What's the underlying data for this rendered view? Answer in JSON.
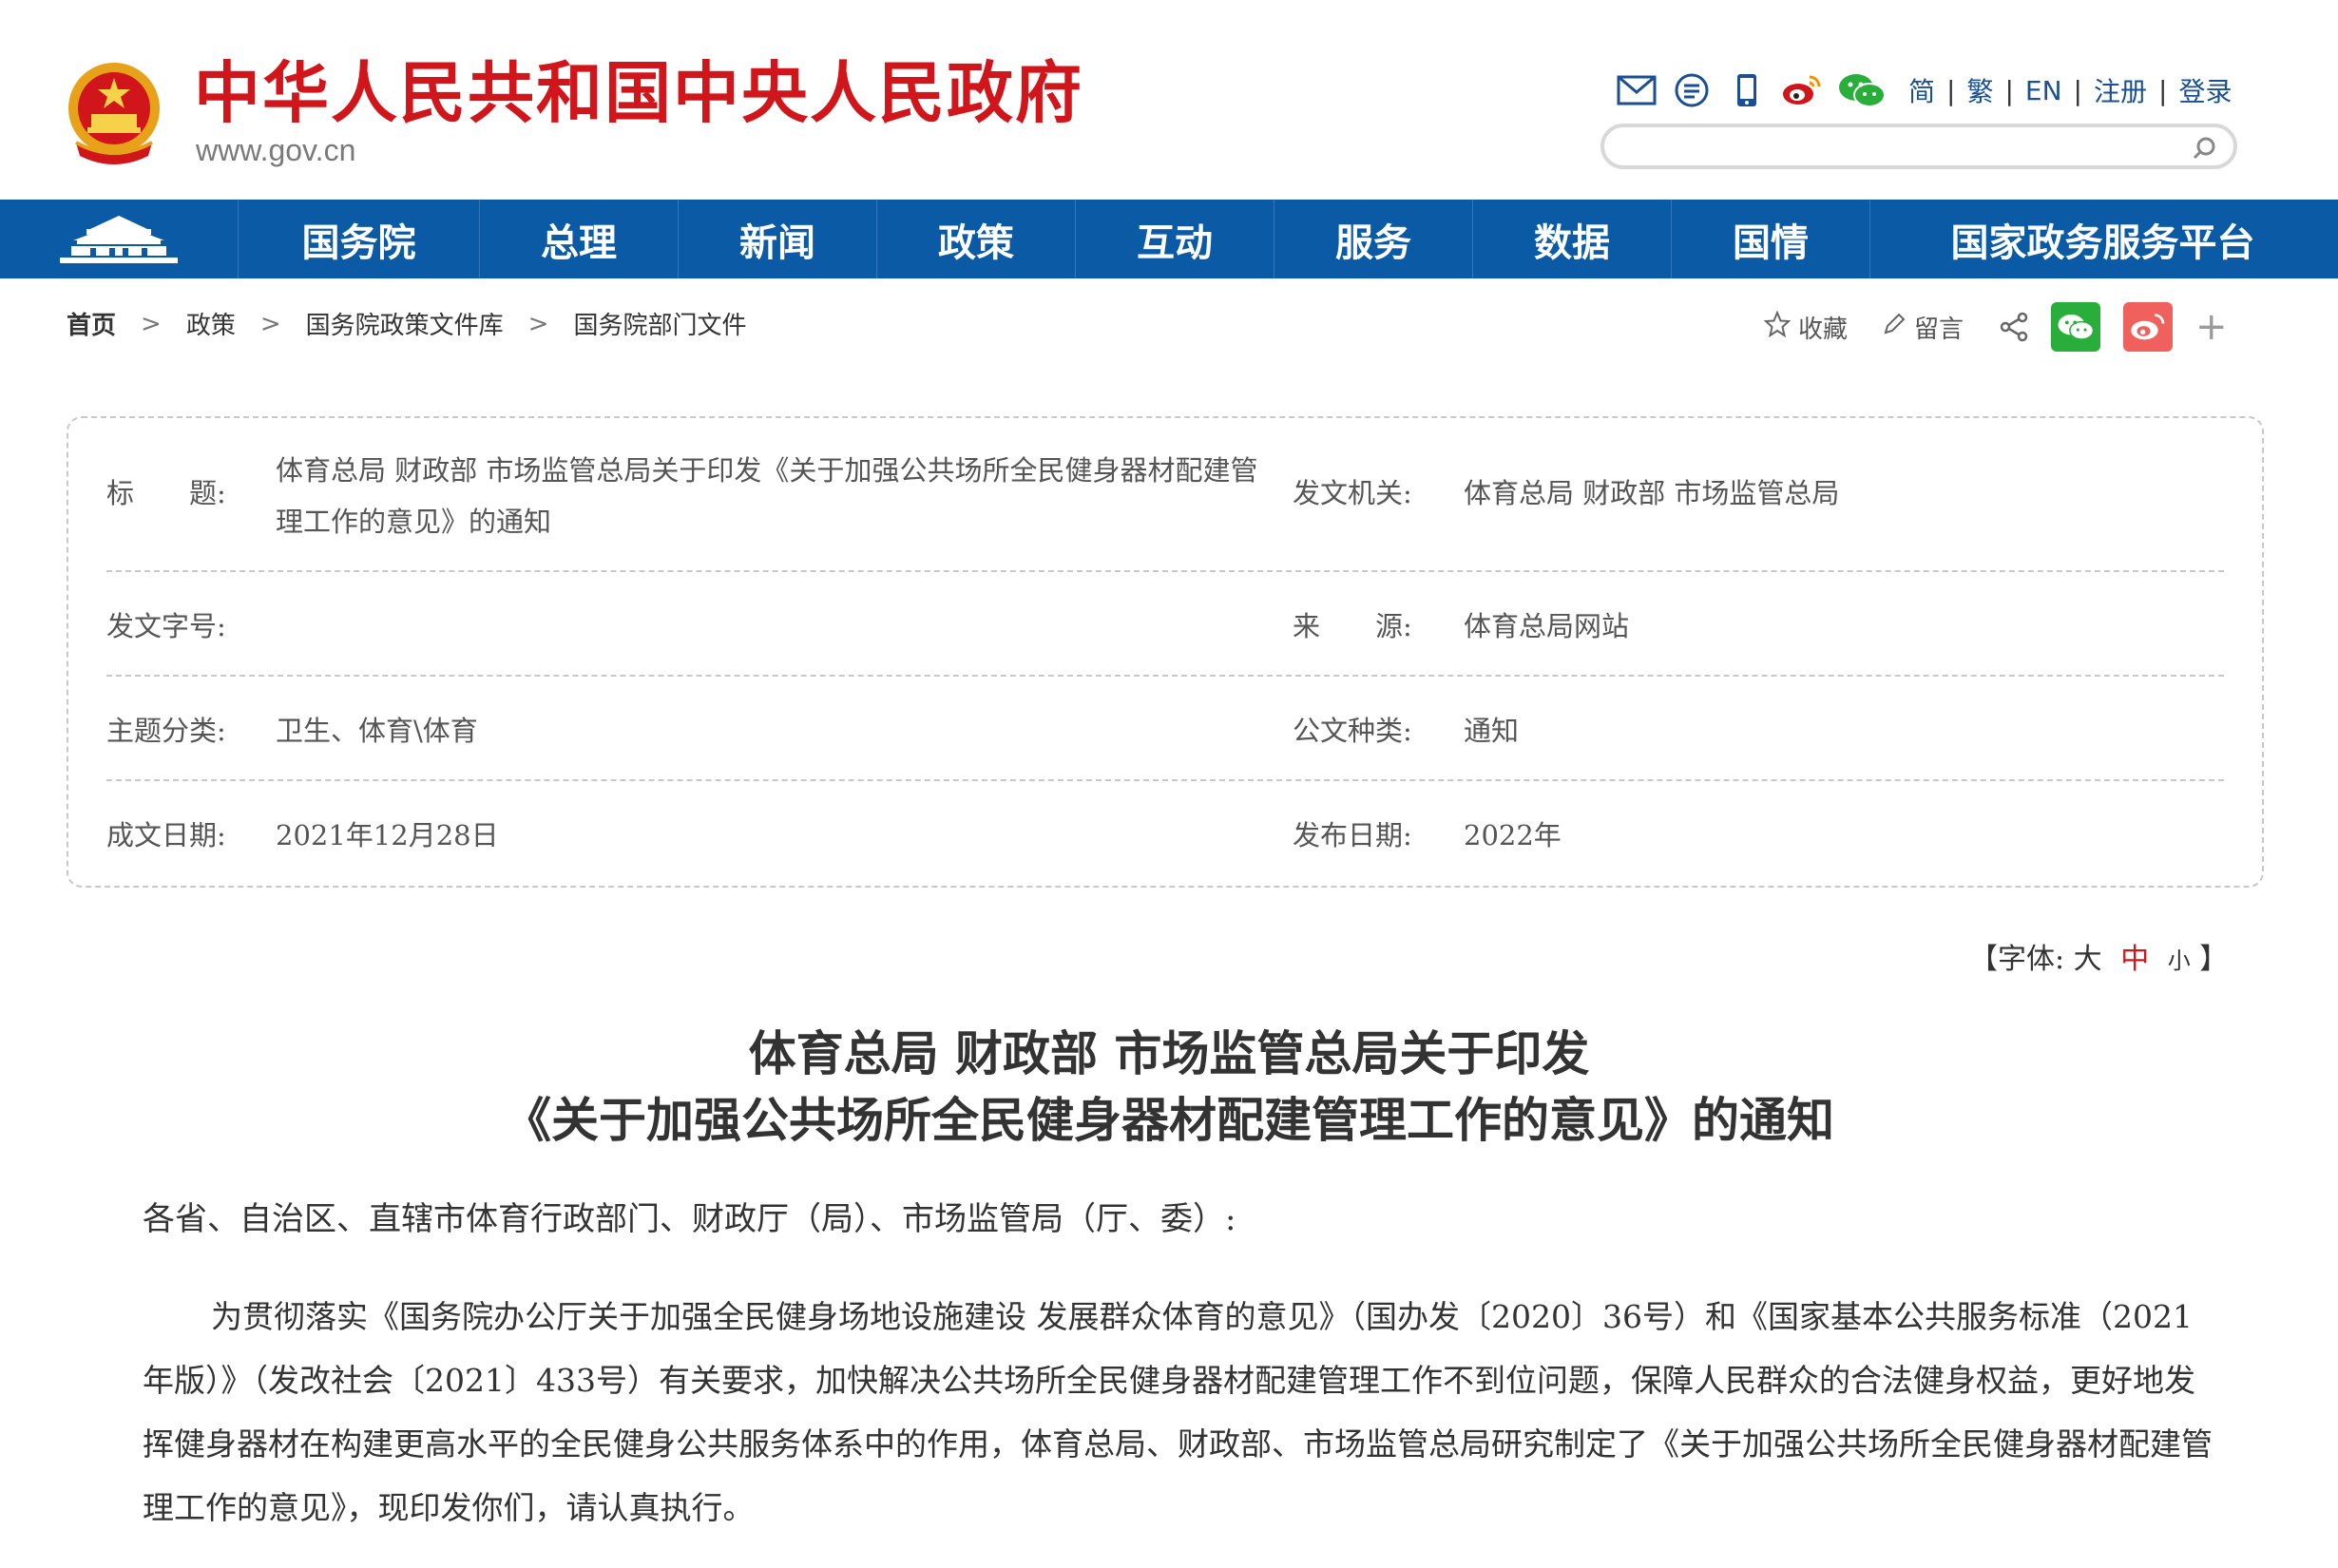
{
  "header": {
    "site_name": "中华人民共和国中央人民政府",
    "site_url": "www.gov.cn",
    "lang_links": [
      "简",
      "繁",
      "EN",
      "注册",
      "登录"
    ],
    "search": {
      "placeholder": ""
    }
  },
  "nav": {
    "items": [
      "国务院",
      "总理",
      "新闻",
      "政策",
      "互动",
      "服务",
      "数据",
      "国情",
      "国家政务服务平台"
    ]
  },
  "breadcrumb": [
    "首页",
    "政策",
    "国务院政策文件库",
    "国务院部门文件"
  ],
  "share": {
    "favorite": "收藏",
    "comment": "留言"
  },
  "info": {
    "title_label": "标　　题:",
    "title_value": "体育总局 财政部 市场监管总局关于印发《关于加强公共场所全民健身器材配建管理工作的意见》的通知",
    "issuer_label": "发文机关:",
    "issuer_value": "体育总局 财政部 市场监管总局",
    "docno_label": "发文字号:",
    "docno_value": "",
    "source_label": "来　　源:",
    "source_value": "体育总局网站",
    "topic_label": "主题分类:",
    "topic_value": "卫生、体育\\体育",
    "type_label": "公文种类:",
    "type_value": "通知",
    "written_label": "成文日期:",
    "written_value": "2021年12月28日",
    "publish_label": "发布日期:",
    "publish_value": "2022年"
  },
  "font_size": {
    "open": "【字体:",
    "large": "大",
    "medium": "中",
    "small": "小",
    "close": "】"
  },
  "article": {
    "title_line1": "体育总局 财政部 市场监管总局关于印发",
    "title_line2": "《关于加强公共场所全民健身器材配建管理工作的意见》的通知",
    "salutation": "各省、自治区、直辖市体育行政部门、财政厅（局）、市场监管局（厅、委）:",
    "paragraph": "为贯彻落实《国务院办公厅关于加强全民健身场地设施建设 发展群众体育的意见》（国办发〔2020〕36号）和《国家基本公共服务标准（2021年版）》（发改社会〔2021〕433号）有关要求，加快解决公共场所全民健身器材配建管理工作不到位问题，保障人民群众的合法健身权益，更好地发挥健身器材在构建更高水平的全民健身公共服务体系中的作用，体育总局、财政部、市场监管总局研究制定了《关于加强公共场所全民健身器材配建管理工作的意见》，现印发你们，请认真执行。"
  },
  "colors": {
    "brand_red": "#d0161b",
    "nav_blue": "#0a5aa5",
    "link_blue": "#1b4f93"
  }
}
